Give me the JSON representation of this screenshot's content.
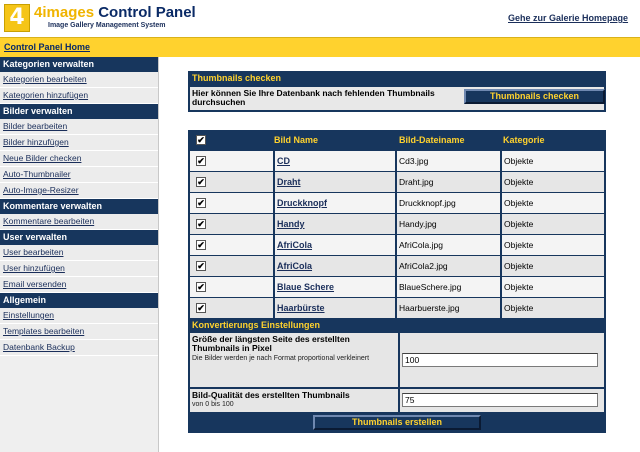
{
  "header": {
    "logo_number": "4",
    "brand": "4images",
    "title": "Control Panel",
    "subtitle": "Image Gallery Management System",
    "gallery_link": "Gehe zur Galerie Homepage"
  },
  "topbar": {
    "home_link": "Control Panel Home"
  },
  "sidebar": {
    "sections": [
      {
        "title": "Kategorien verwalten",
        "items": [
          "Kategorien bearbeiten",
          "Kategorien hinzufügen"
        ]
      },
      {
        "title": "Bilder verwalten",
        "items": [
          "Bilder bearbeiten",
          "Bilder hinzufügen",
          "Neue Bilder checken",
          "Auto-Thumbnailer",
          "Auto-Image-Resizer"
        ]
      },
      {
        "title": "Kommentare verwalten",
        "items": [
          "Kommentare bearbeiten"
        ]
      },
      {
        "title": "User verwalten",
        "items": [
          "User bearbeiten",
          "User hinzufügen",
          "Email versenden"
        ]
      },
      {
        "title": "Allgemein",
        "items": [
          "Einstellungen",
          "Templates bearbeiten",
          "Datenbank Backup"
        ]
      }
    ]
  },
  "check_panel": {
    "title": "Thumbnails checken",
    "description": "Hier können Sie Ihre Datenbank nach fehlenden Thumbnails durchsuchen",
    "button": "Thumbnails checken"
  },
  "table": {
    "headers": {
      "name": "Bild Name",
      "file": "Bild-Dateiname",
      "category": "Kategorie"
    },
    "rows": [
      {
        "name": "CD",
        "file": "Cd3.jpg",
        "category": "Objekte",
        "checked": true
      },
      {
        "name": "Draht",
        "file": "Draht.jpg",
        "category": "Objekte",
        "checked": true
      },
      {
        "name": "Druckknopf",
        "file": "Druckknopf.jpg",
        "category": "Objekte",
        "checked": true
      },
      {
        "name": "Handy",
        "file": "Handy.jpg",
        "category": "Objekte",
        "checked": true
      },
      {
        "name": "AfriCola",
        "file": "AfriCola.jpg",
        "category": "Objekte",
        "checked": true
      },
      {
        "name": "AfriCola",
        "file": "AfriCola2.jpg",
        "category": "Objekte",
        "checked": true
      },
      {
        "name": "Blaue Schere",
        "file": "BlaueSchere.jpg",
        "category": "Objekte",
        "checked": true
      },
      {
        "name": "Haarbürste",
        "file": "Haarbuerste.jpg",
        "category": "Objekte",
        "checked": true
      }
    ]
  },
  "conversion": {
    "title": "Konvertierungs Einstellungen",
    "size_label": "Größe der längsten Seite des erstellten Thumbnails in Pixel",
    "size_hint": "Die Bilder werden je nach Format proportional verkleinert",
    "size_value": "100",
    "quality_label": "Bild-Qualität des erstellten Thumbnails",
    "quality_hint": "von 0 bis 100",
    "quality_value": "75",
    "button": "Thumbnails erstellen"
  },
  "colors": {
    "navy": "#17365d",
    "yellow": "#ffd22e",
    "row_gray": "#e6e6e6"
  }
}
